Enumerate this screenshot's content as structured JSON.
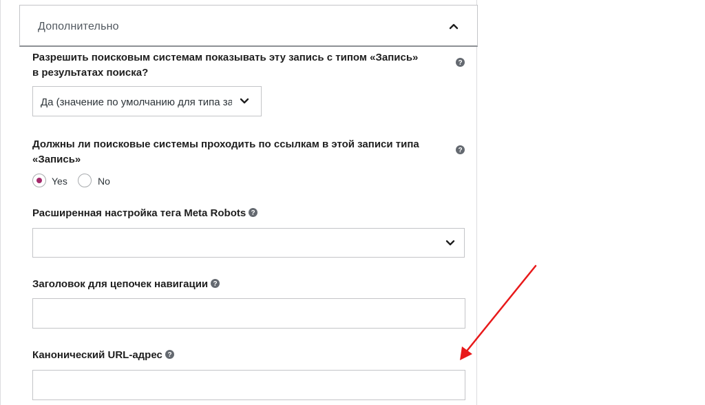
{
  "accordion": {
    "title": "Дополнительно",
    "icon": "chevron-up-icon"
  },
  "fields": {
    "search_visibility": {
      "label_line1": "Разрешить поисковым системам показывать эту запись с типом «Запись»",
      "label_line2": "в результатах поиска?",
      "selected": "Да (значение по умолчанию для типа записи)"
    },
    "follow_links": {
      "label_line1": "Должны ли поисковые системы проходить по ссылкам в этой записи типа",
      "label_line2": "«Запись»",
      "options": [
        "Yes",
        "No"
      ],
      "selected": "Yes"
    },
    "meta_robots": {
      "label": "Расширенная настройка тега Meta Robots",
      "value": ""
    },
    "breadcrumbs_title": {
      "label": "Заголовок для цепочек навигации",
      "value": ""
    },
    "canonical_url": {
      "label": "Канонический URL-адрес",
      "value": ""
    }
  },
  "colors": {
    "accent_radio": "#a4286a",
    "arrow": "#e8191a",
    "border": "#c3c4c7"
  }
}
